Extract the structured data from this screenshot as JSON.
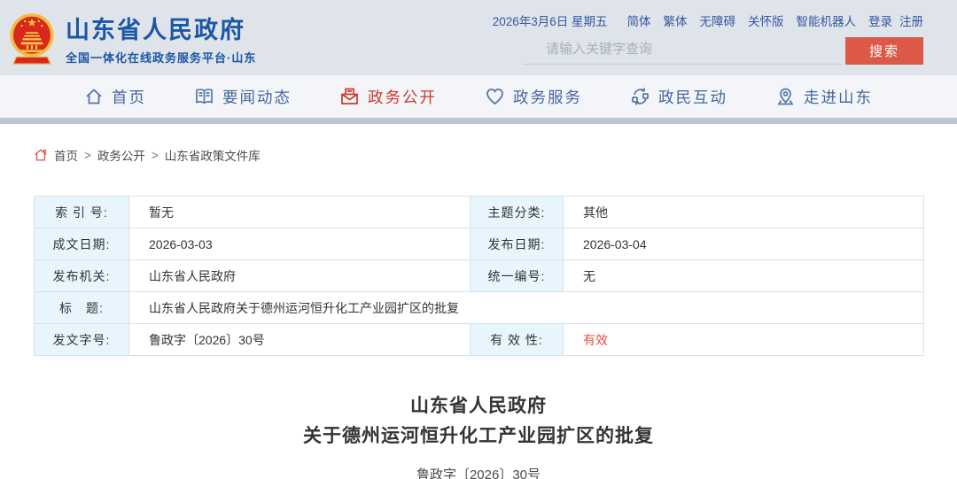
{
  "header": {
    "site_title": "山东省人民政府",
    "site_subtitle": "全国一体化在线政务服务平台·山东",
    "date": "2026年3月6日 星期五",
    "links": [
      "简体",
      "繁体",
      "无障碍",
      "关怀版",
      "智能机器人",
      "登录",
      "注册"
    ],
    "search": {
      "placeholder": "请输入关键字查询",
      "button_label": "搜索"
    }
  },
  "nav": {
    "items": [
      {
        "label": "首页",
        "icon": "home-icon",
        "active": false
      },
      {
        "label": "要闻动态",
        "icon": "book-icon",
        "active": false
      },
      {
        "label": "政务公开",
        "icon": "envelope-icon",
        "active": true
      },
      {
        "label": "政务服务",
        "icon": "heart-icon",
        "active": false
      },
      {
        "label": "政民互动",
        "icon": "interaction-icon",
        "active": false
      },
      {
        "label": "走进山东",
        "icon": "map-pin-icon",
        "active": false
      }
    ]
  },
  "breadcrumb": {
    "separator": ">",
    "items": [
      "首页",
      "政务公开",
      "山东省政策文件库"
    ]
  },
  "doc_info": {
    "index_label": "索 引 号:",
    "index_value": "暂无",
    "topic_label": "主题分类:",
    "topic_value": "其他",
    "written_date_label": "成文日期:",
    "written_date_value": "2026-03-03",
    "publish_date_label": "发布日期:",
    "publish_date_value": "2026-03-04",
    "publisher_label": "发布机关:",
    "publisher_value": "山东省人民政府",
    "unified_no_label": "统一编号:",
    "unified_no_value": "无",
    "title_label": "标　题:",
    "title_value": "山东省人民政府关于德州运河恒升化工产业园扩区的批复",
    "doc_no_label": "发文字号:",
    "doc_no_value": "鲁政字〔2026〕30号",
    "validity_label": "有 效 性:",
    "validity_value": "有效"
  },
  "document": {
    "title_line1": "山东省人民政府",
    "title_line2": "关于德州运河恒升化工产业园扩区的批复",
    "doc_number": "鲁政字〔2026〕30号"
  },
  "colors": {
    "brand_blue": "#1c57a5",
    "nav_blue": "#44689c",
    "active_red": "#cd382d",
    "search_button_red": "#dc5948",
    "validity_red": "#e8503e",
    "label_cell_bg": "#e9f5fd",
    "header_bg": "#dfe3ea"
  }
}
